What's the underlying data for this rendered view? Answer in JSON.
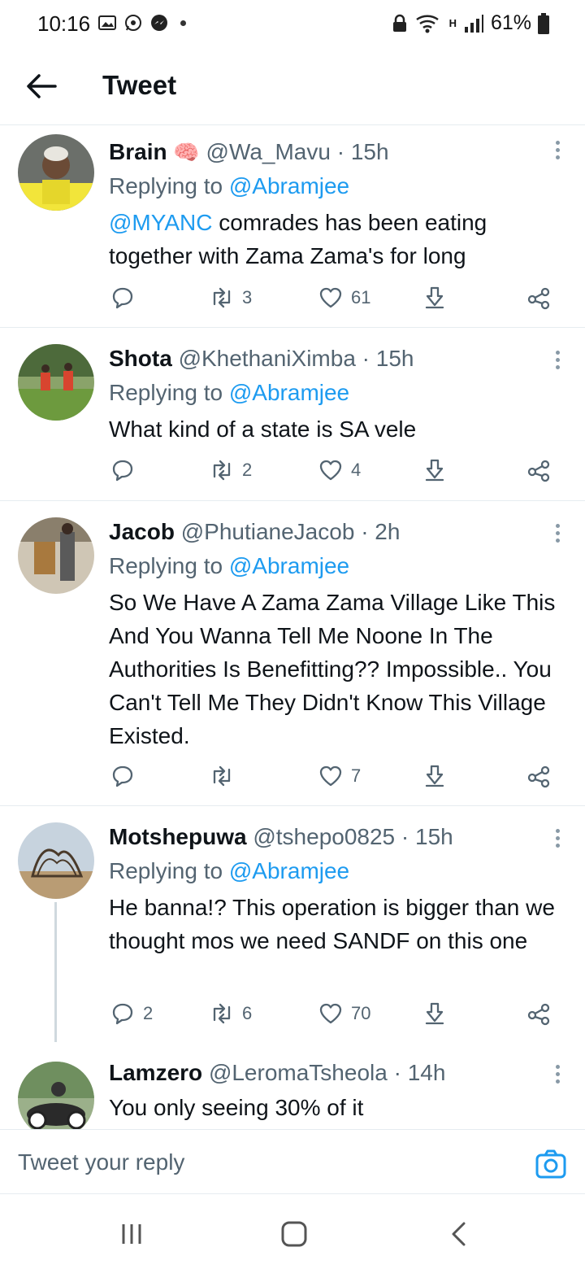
{
  "status_bar": {
    "time": "10:16",
    "battery": "61%",
    "network": "H"
  },
  "header": {
    "title": "Tweet"
  },
  "tweets": [
    {
      "name": "Brain",
      "emoji": "🧠",
      "handle": "@Wa_Mavu",
      "time": "· 15h",
      "replying_prefix": "Replying to",
      "replying_to": "@Abramjee",
      "mention": "@MYANC",
      "text": " comrades has been eating together with Zama Zama's for long",
      "replies": "",
      "retweets": "3",
      "likes": "61"
    },
    {
      "name": "Shota",
      "handle": "@KhethaniXimba",
      "time": "· 15h",
      "replying_prefix": "Replying to",
      "replying_to": "@Abramjee",
      "text": "What kind of a state is SA vele",
      "replies": "",
      "retweets": "2",
      "likes": "4"
    },
    {
      "name": "Jacob",
      "handle": "@PhutianeJacob",
      "time": "· 2h",
      "replying_prefix": "Replying to",
      "replying_to": "@Abramjee",
      "text": "So We Have A Zama Zama Village Like This And You Wanna Tell Me Noone In The Authorities Is Benefitting?? Impossible.. You Can't Tell Me They Didn't Know This Village Existed.",
      "replies": "",
      "retweets": "",
      "likes": "7"
    },
    {
      "name": "Motshepuwa",
      "handle": "@tshepo0825",
      "time": "· 15h",
      "replying_prefix": "Replying to",
      "replying_to": "@Abramjee",
      "text": "He banna!? This operation is bigger than we thought mos we need SANDF on this one",
      "replies": "2",
      "retweets": "6",
      "likes": "70"
    },
    {
      "name": "Lamzero",
      "handle": "@LeromaTsheola",
      "time": "· 14h",
      "text": "You only seeing 30% of it"
    }
  ],
  "reply_box": {
    "placeholder": "Tweet your reply"
  },
  "colors": {
    "link": "#1d9bf0",
    "secondary_text": "#536471",
    "divider": "#e6ecf0"
  }
}
